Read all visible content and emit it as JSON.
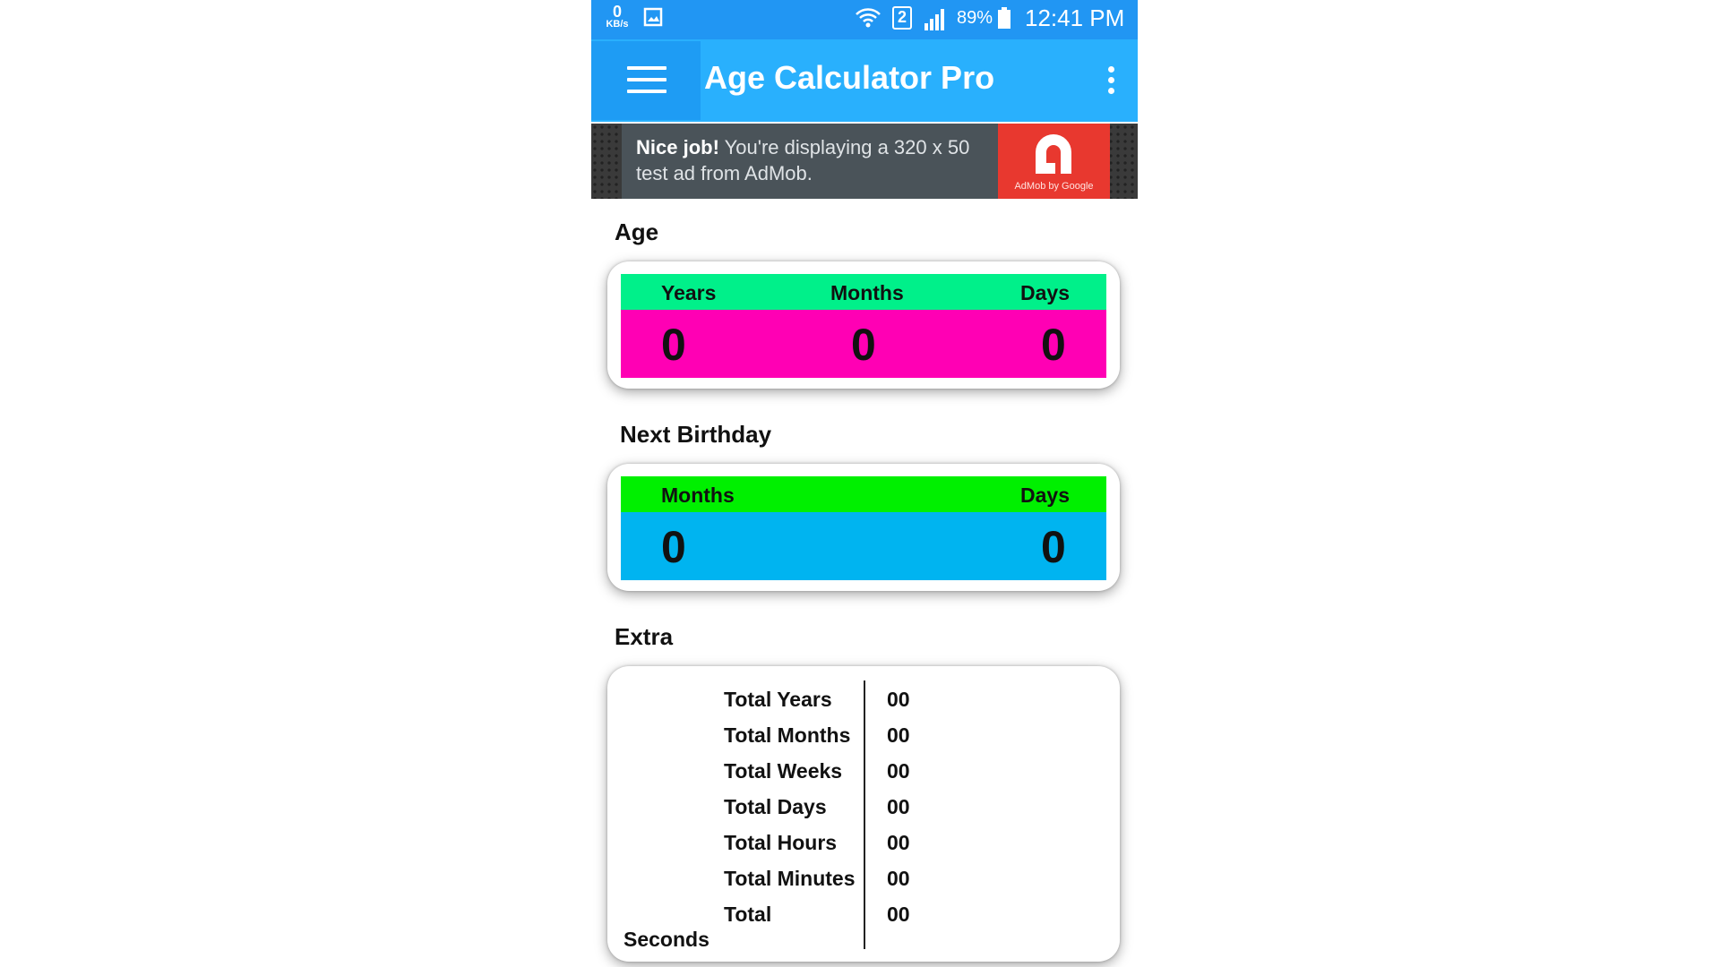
{
  "status_bar": {
    "net_speed": "0",
    "net_unit": "KB/s",
    "sim": "2",
    "battery": "89%",
    "time": "12:41 PM",
    "icons": [
      "image-icon",
      "wifi-icon",
      "signal-icon",
      "battery-icon"
    ]
  },
  "app_bar": {
    "title": "Age Calculator Pro",
    "menu_icon": "hamburger-icon",
    "overflow_icon": "more-vert-icon",
    "color": "#29b0fd"
  },
  "ad": {
    "bold": "Nice job!",
    "text": " You're displaying a 320 x 50 test ad from AdMob.",
    "brand": "AdMob by Google"
  },
  "age": {
    "title": "Age",
    "headers": [
      "Years",
      "Months",
      "Days"
    ],
    "values": [
      "0",
      "0",
      "0"
    ],
    "header_color": "#00f08a",
    "value_color": "#ff00b4"
  },
  "next_birthday": {
    "title": "Next Birthday",
    "headers": [
      "Months",
      "Days"
    ],
    "values": [
      "0",
      "0"
    ],
    "header_color": "#00f000",
    "value_color": "#00b4f0"
  },
  "extra": {
    "title": "Extra",
    "rows": [
      {
        "label": "Total Years",
        "value": "00"
      },
      {
        "label": "Total Months",
        "value": "00"
      },
      {
        "label": "Total Weeks",
        "value": "00"
      },
      {
        "label": "Total Days",
        "value": "00"
      },
      {
        "label": "Total Hours",
        "value": "00"
      },
      {
        "label": "Total Minutes",
        "value": "00"
      },
      {
        "label": "Total",
        "value": "00"
      }
    ],
    "wrap_label": "Seconds"
  }
}
